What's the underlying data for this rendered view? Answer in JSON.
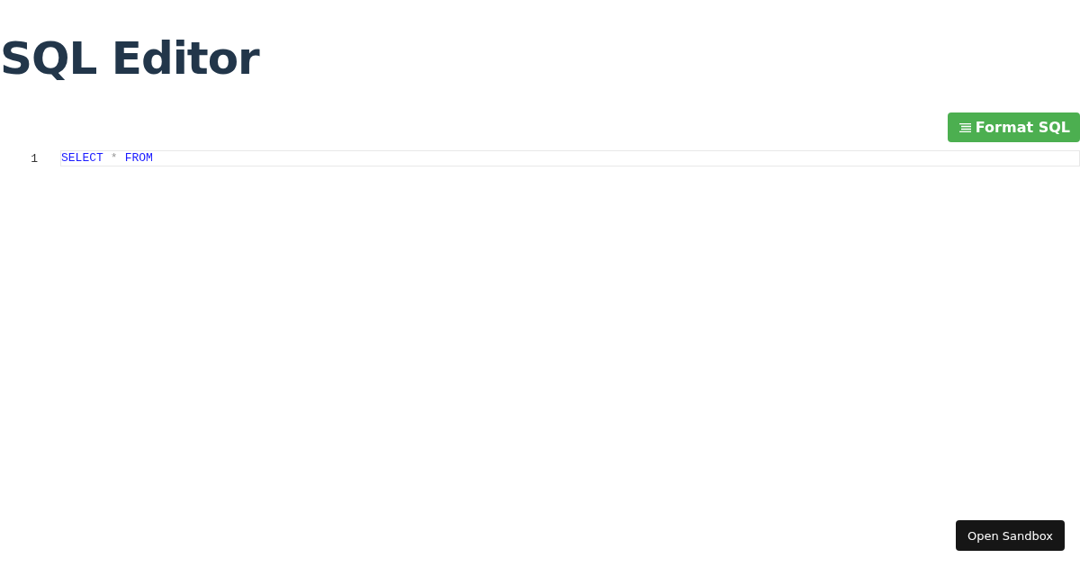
{
  "title": "SQL Editor",
  "format_button": {
    "label": "Format SQL"
  },
  "editor": {
    "lines": [
      {
        "number": "1",
        "active": true,
        "tokens": [
          {
            "kind": "keyword",
            "text": "SELECT"
          },
          {
            "kind": "operator",
            "text": "*"
          },
          {
            "kind": "keyword",
            "text": "FROM"
          }
        ]
      }
    ]
  },
  "sandbox_button": {
    "label": "Open Sandbox"
  }
}
